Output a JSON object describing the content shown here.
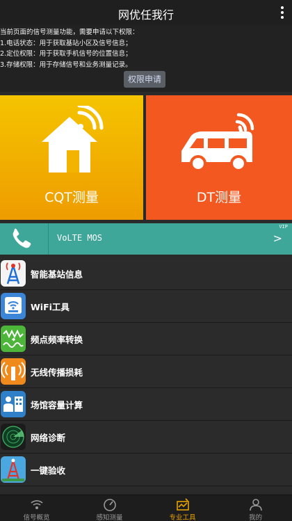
{
  "header": {
    "title": "网优任我行",
    "menu_icon": "more-vertical-icon"
  },
  "permission": {
    "lines": [
      "当前页面的信号测量功能，需要申请以下权限：",
      "1.电话状态：用于获取基站小区及信号信息；",
      "2.定位权限：用于获取手机信号的位置信息；",
      "3.存储权限：用于存储信号和业务测量记录。"
    ],
    "button_label": "权限申请"
  },
  "tiles": {
    "cqt": {
      "label": "CQT测量",
      "icon": "home-signal-icon",
      "color": "#f2b400"
    },
    "dt": {
      "label": "DT测量",
      "icon": "car-signal-icon",
      "color": "#f2581f"
    }
  },
  "volte": {
    "label": "VoLTE MOS",
    "badge": "VIP",
    "icon": "phone-icon",
    "chevron": ">",
    "color": "#3ea79a"
  },
  "tools": [
    {
      "label": "智能基站信息",
      "icon": "cell-tower-icon"
    },
    {
      "label": "WiFi工具",
      "icon": "wifi-icon"
    },
    {
      "label": "频点频率转换",
      "icon": "frequency-convert-icon"
    },
    {
      "label": "无线传播损耗",
      "icon": "propagation-icon"
    },
    {
      "label": "场馆容量计算",
      "icon": "venue-capacity-icon"
    },
    {
      "label": "网络诊断",
      "icon": "radar-icon"
    },
    {
      "label": "一键验收",
      "icon": "acceptance-icon"
    }
  ],
  "tabbar": {
    "tabs": [
      {
        "label": "信号概览",
        "icon": "signal-overview-icon",
        "active": false
      },
      {
        "label": "感知测量",
        "icon": "gauge-icon",
        "active": false
      },
      {
        "label": "专业工具",
        "icon": "toolbox-icon",
        "active": true
      },
      {
        "label": "我的",
        "icon": "user-icon",
        "active": false
      }
    ],
    "active_color": "#e8a200"
  }
}
